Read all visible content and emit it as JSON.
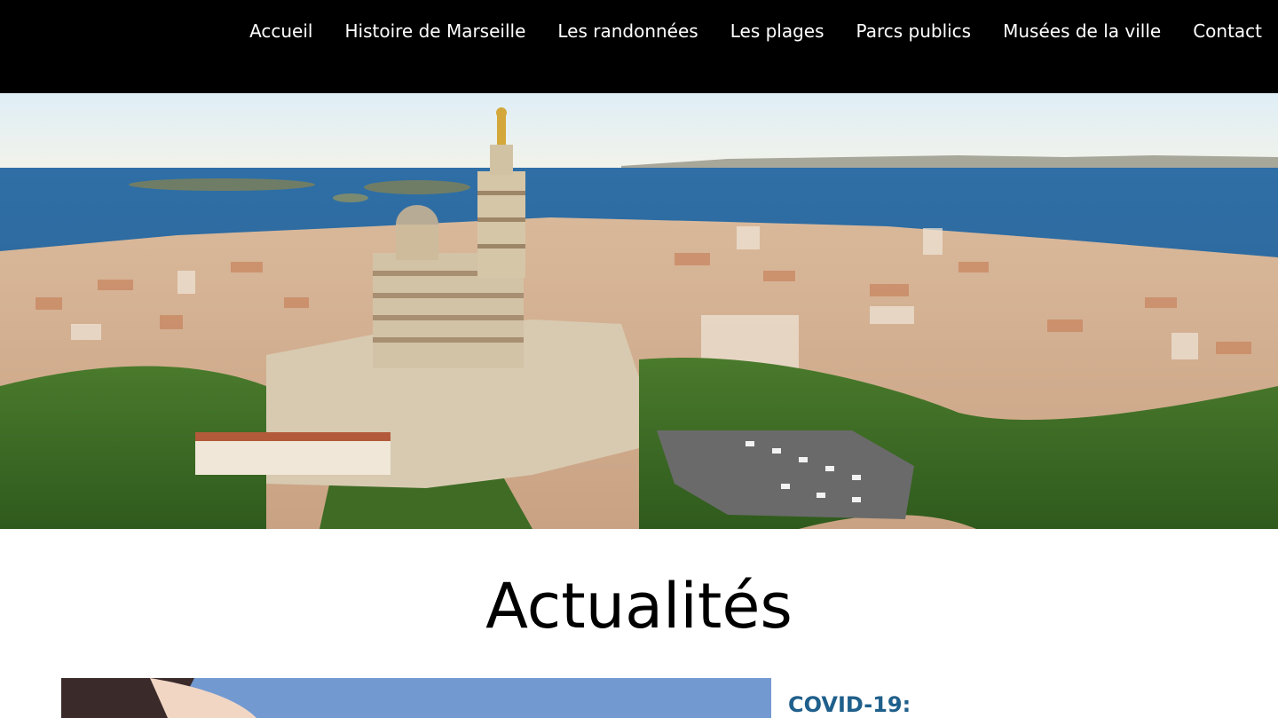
{
  "nav": {
    "items": [
      {
        "label": "Accueil"
      },
      {
        "label": "Histoire de Marseille"
      },
      {
        "label": "Les randonnées"
      },
      {
        "label": "Les plages"
      },
      {
        "label": "Parcs publics"
      },
      {
        "label": "Musées de la ville"
      },
      {
        "label": "Contact"
      }
    ]
  },
  "colors": {
    "nav_background": "#000000",
    "nav_text": "#ffffff",
    "news_heading": "#1f5f8b"
  },
  "main": {
    "section_title": "Actualités",
    "news": [
      {
        "heading": "COVID-19:"
      }
    ]
  }
}
